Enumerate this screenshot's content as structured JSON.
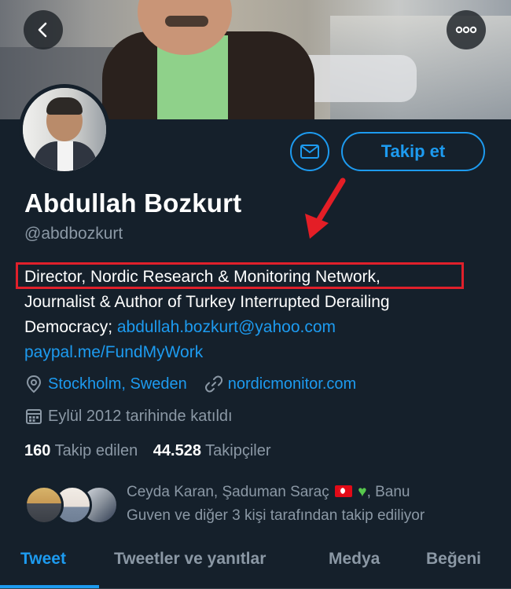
{
  "profile": {
    "name": "Abdullah Bozkurt",
    "handle": "@abdbozkurt",
    "follow_label": "Takip et",
    "bio": {
      "line1": "Director, Nordic Research & Monitoring Network,",
      "line2": "Journalist & Author of Turkey Interrupted Derailing",
      "line3_text": "Democracy; ",
      "email": "abdullah.bozkurt@yahoo.com",
      "paypal": "paypal.me/FundMyWork"
    },
    "location": "Stockholm, Sweden",
    "website": "nordicmonitor.com",
    "joined": "Eylül 2012 tarihinde katıldı",
    "following_count": "160",
    "following_label": "Takip edilen",
    "followers_count": "44.528",
    "followers_label": "Takipçiler",
    "followed_by_part1": "Ceyda Karan, Şaduman Saraç",
    "followed_by_part2": ", Banu",
    "followed_by_line2": "Guven ve diğer 3 kişi tarafından takip ediliyor"
  },
  "tabs": [
    {
      "label": "Tweet",
      "active": true
    },
    {
      "label": "Tweetler ve yanıtlar",
      "active": false
    },
    {
      "label": "Medya",
      "active": false
    },
    {
      "label": "Beğeni",
      "active": false
    }
  ],
  "colors": {
    "background": "#15202b",
    "accent": "#1d9bf0",
    "secondary_text": "#8b98a5",
    "highlight": "#e0202b"
  },
  "icons": {
    "back": "chevron-left-icon",
    "more": "more-horizontal-icon",
    "mail": "mail-icon",
    "location": "location-pin-icon",
    "link": "link-icon",
    "calendar": "calendar-icon",
    "arrow": "red-arrow-annotation"
  }
}
